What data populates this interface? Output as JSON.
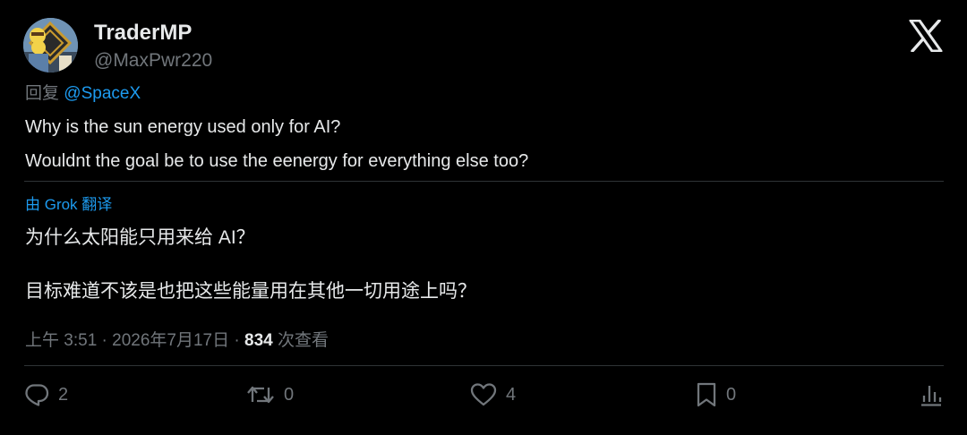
{
  "author": {
    "display_name": "TraderMP",
    "handle": "@MaxPwr220"
  },
  "reply_context": {
    "prefix": "回复",
    "mention": "@SpaceX"
  },
  "tweet": {
    "lines": [
      "Why is the sun energy used only for AI?",
      "Wouldnt the goal be to use the eenergy for everything else too?"
    ]
  },
  "translation": {
    "label": "由 Grok 翻译",
    "lines": [
      "为什么太阳能只用来给 AI？",
      "目标难道不该是也把这些能量用在其他一切用途上吗？"
    ]
  },
  "meta": {
    "time": "上午 3:51",
    "date": "2026年7月17日",
    "views_count": "834",
    "views_label": "次查看",
    "separator": "·"
  },
  "actions": {
    "reply_count": "2",
    "repost_count": "0",
    "like_count": "4",
    "bookmark_count": "0"
  },
  "colors": {
    "background": "#000000",
    "text": "#e7e9ea",
    "muted": "#71767b",
    "accent": "#1d9bf0",
    "divider": "#2f3336"
  },
  "icons": [
    "x-logo-icon",
    "reply-icon",
    "repost-icon",
    "like-icon",
    "bookmark-icon",
    "analytics-icon"
  ]
}
